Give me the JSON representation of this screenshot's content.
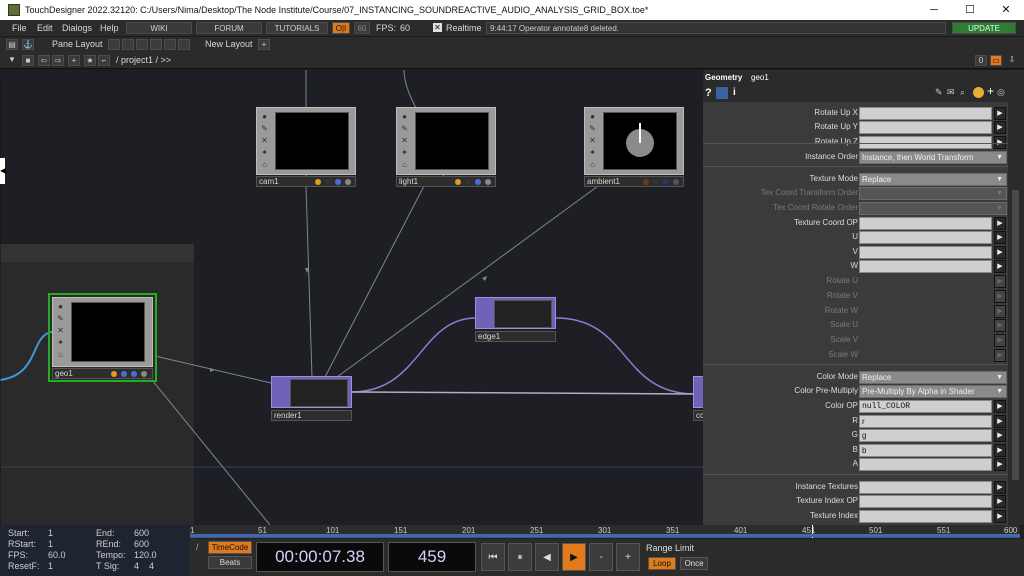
{
  "window": {
    "title": "TouchDesigner 2022.32120: C:/Users/Nima/Desktop/The Node Institute/Course/07_INSTANCING_SOUNDREACTIVE_AUDIO_ANALYSIS_GRID_BOX.toe*",
    "minimize": "─",
    "maximize": "☐",
    "close": "✕"
  },
  "menu": {
    "file": "File",
    "edit": "Edit",
    "dialogs": "Dialogs",
    "help": "Help",
    "wiki": "WIKI",
    "forum": "FORUM",
    "tutorials": "TUTORIALS",
    "oi": "O|I",
    "fps_target": "60",
    "fps_label": "FPS:",
    "fps_value": "60",
    "realtime": "Realtime",
    "status": "9:44:17 Operator annotate8 deleted.",
    "update": "UPDATE"
  },
  "toolbar": {
    "pane_layout": "Pane Layout",
    "new_layout": "New Layout",
    "plus": "+"
  },
  "pathbar": {
    "path": "/ project1 / >>",
    "zero": "0"
  },
  "nodes": {
    "cam": "cam1",
    "light": "light1",
    "ambient": "ambient1",
    "geo": "geo1",
    "edge": "edge1",
    "render": "render1",
    "comp": "co"
  },
  "params": {
    "header_type": "Geometry",
    "header_name": "geo1",
    "rows": [
      {
        "label": "Rotate Up X",
        "kind": "field",
        "value": ""
      },
      {
        "label": "Rotate Up Y",
        "kind": "field",
        "value": ""
      },
      {
        "label": "Rotate Up Z",
        "kind": "field",
        "value": ""
      },
      {
        "label": "Instance Order",
        "kind": "menu",
        "value": "Instance, then World Transform"
      },
      {
        "label": "Texture Mode",
        "kind": "menu",
        "value": "Replace"
      },
      {
        "label": "Tex Coord Transform Order",
        "kind": "menu",
        "value": "",
        "dim": true
      },
      {
        "label": "Tex Coord Rotate Order",
        "kind": "menu",
        "value": "",
        "dim": true
      },
      {
        "label": "Texture Coord OP",
        "kind": "field",
        "value": ""
      },
      {
        "label": "U",
        "kind": "field",
        "value": ""
      },
      {
        "label": "V",
        "kind": "field",
        "value": ""
      },
      {
        "label": "W",
        "kind": "field",
        "value": ""
      },
      {
        "label": "Rotate U",
        "kind": "dim"
      },
      {
        "label": "Rotate V",
        "kind": "dim"
      },
      {
        "label": "Rotate W",
        "kind": "dim"
      },
      {
        "label": "Scale U",
        "kind": "dim"
      },
      {
        "label": "Scale V",
        "kind": "dim"
      },
      {
        "label": "Scale W",
        "kind": "dim"
      },
      {
        "label": "Color Mode",
        "kind": "menu",
        "value": "Replace"
      },
      {
        "label": "Color Pre-Multiply",
        "kind": "menu",
        "value": "Pre-Multiply By Alpha in Shader"
      },
      {
        "label": "Color OP",
        "kind": "field",
        "value": "null_COLOR",
        "mono": true
      },
      {
        "label": "R",
        "kind": "field",
        "value": "r"
      },
      {
        "label": "G",
        "kind": "field",
        "value": "g"
      },
      {
        "label": "B",
        "kind": "field",
        "value": "b"
      },
      {
        "label": "A",
        "kind": "field",
        "value": ""
      },
      {
        "label": "Instance Textures",
        "kind": "field",
        "value": ""
      },
      {
        "label": "Texture Index OP",
        "kind": "field",
        "value": ""
      },
      {
        "label": "Texture Index",
        "kind": "field",
        "value": ""
      }
    ]
  },
  "timeinfo": {
    "start_l": "Start:",
    "start_v": "1",
    "end_l": "End:",
    "end_v": "600",
    "rstart_l": "RStart:",
    "rstart_v": "1",
    "rend_l": "REnd:",
    "rend_v": "600",
    "fps_l": "FPS:",
    "fps_v": "60.0",
    "tempo_l": "Tempo:",
    "tempo_v": "120.0",
    "resetf_l": "ResetF:",
    "resetf_v": "1",
    "tsig_l": "T Sig:",
    "tsig_v": "4    4"
  },
  "ruler": [
    "1",
    "51",
    "101",
    "151",
    "201",
    "251",
    "301",
    "351",
    "401",
    "451",
    "501",
    "551",
    "600"
  ],
  "transport": {
    "timecode_btn": "TimeCode",
    "beats_btn": "Beats",
    "timecode": "00:00:07.38",
    "frame": "459",
    "range_limit": "Range Limit",
    "loop": "Loop",
    "once": "Once"
  }
}
